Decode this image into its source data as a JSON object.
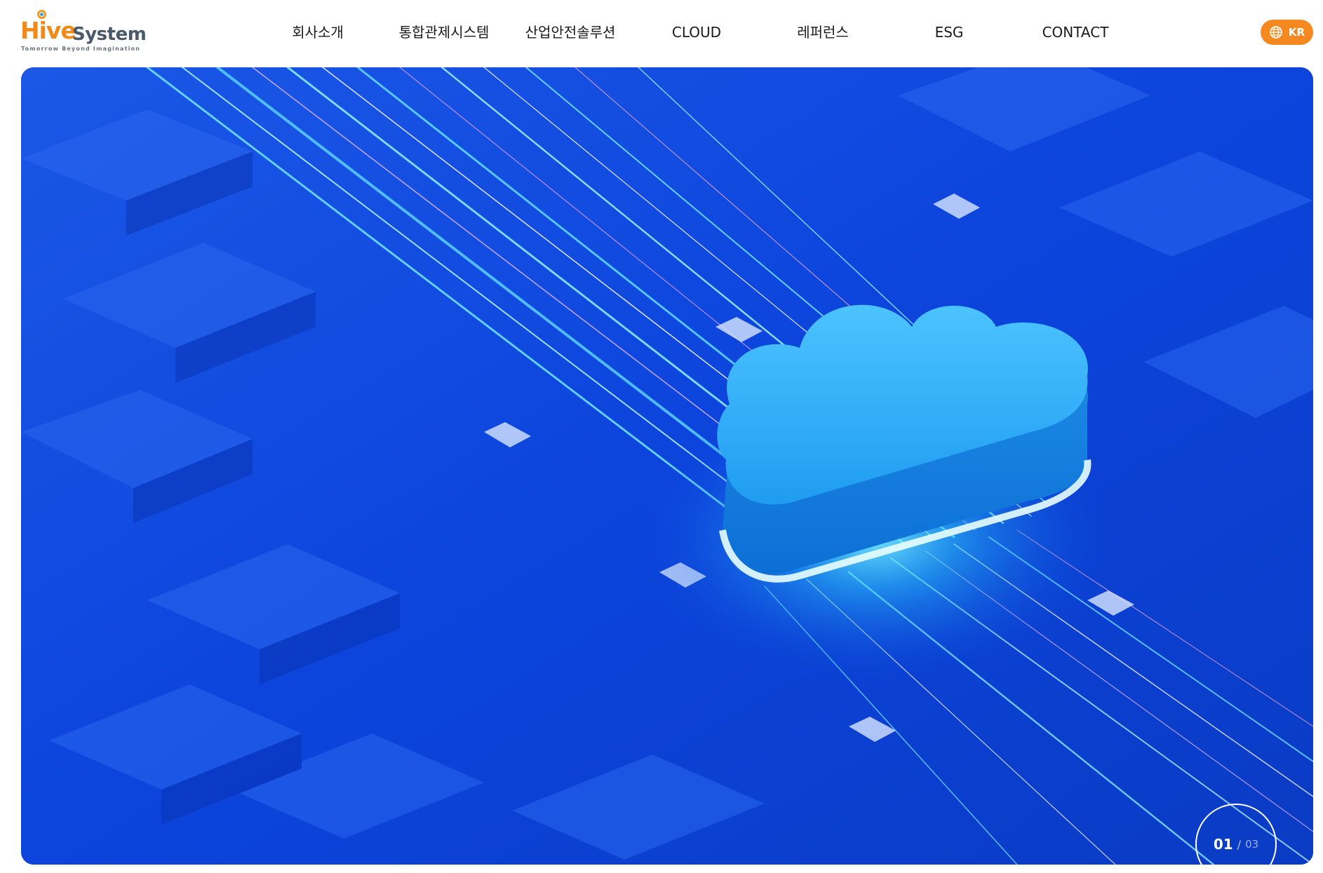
{
  "brand": {
    "name_part1": "Hive",
    "name_part2": "System",
    "tagline": "Tomorrow Beyond Imagination"
  },
  "nav": {
    "items": [
      {
        "label": "회사소개"
      },
      {
        "label": "통합관제시스템"
      },
      {
        "label": "산업안전솔루션"
      },
      {
        "label": "CLOUD"
      },
      {
        "label": "레퍼런스"
      },
      {
        "label": "ESG"
      },
      {
        "label": "CONTACT"
      }
    ]
  },
  "language": {
    "label": "KR",
    "icon": "globe-icon"
  },
  "hero": {
    "image_icon": "cloud-icon",
    "slide_current": "01",
    "slide_separator": "/",
    "slide_total": "03"
  },
  "colors": {
    "brand_orange": "#f5891f",
    "hero_blue": "#0a47e0",
    "cloud_cyan": "#3db8ff"
  }
}
